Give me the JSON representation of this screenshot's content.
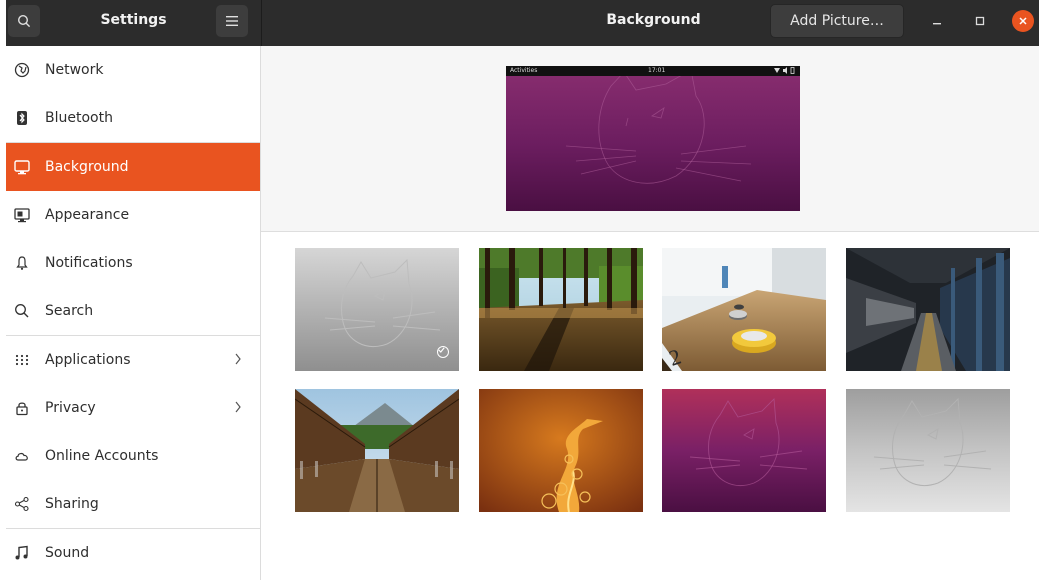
{
  "header": {
    "settings_title": "Settings",
    "page_title": "Background",
    "add_picture_label": "Add Picture…"
  },
  "sidebar": {
    "items": [
      {
        "label": "Network",
        "icon": "network-icon"
      },
      {
        "label": "Bluetooth",
        "icon": "bluetooth-icon"
      },
      {
        "label": "Background",
        "icon": "background-icon",
        "active": true
      },
      {
        "label": "Appearance",
        "icon": "appearance-icon"
      },
      {
        "label": "Notifications",
        "icon": "bell-icon"
      },
      {
        "label": "Search",
        "icon": "search-icon"
      },
      {
        "label": "Applications",
        "icon": "grid-icon",
        "has_submenu": true
      },
      {
        "label": "Privacy",
        "icon": "lock-icon",
        "has_submenu": true
      },
      {
        "label": "Online Accounts",
        "icon": "cloud-icon"
      },
      {
        "label": "Sharing",
        "icon": "share-icon"
      },
      {
        "label": "Sound",
        "icon": "music-note-icon"
      }
    ]
  },
  "preview": {
    "top_bar_left": "Activities",
    "top_bar_time": "17:01"
  },
  "wallpapers": [
    {
      "name": "grey-fossa",
      "selected": true
    },
    {
      "name": "forest-path"
    },
    {
      "name": "shuffleboard"
    },
    {
      "name": "subway-station"
    },
    {
      "name": "suspension-bridge"
    },
    {
      "name": "orange-abstract"
    },
    {
      "name": "purple-fossa"
    },
    {
      "name": "light-grey-fossa"
    }
  ],
  "colors": {
    "accent": "#e95420",
    "headerbar": "#2c2c2c",
    "preview_purple": "#6b1d5f"
  }
}
